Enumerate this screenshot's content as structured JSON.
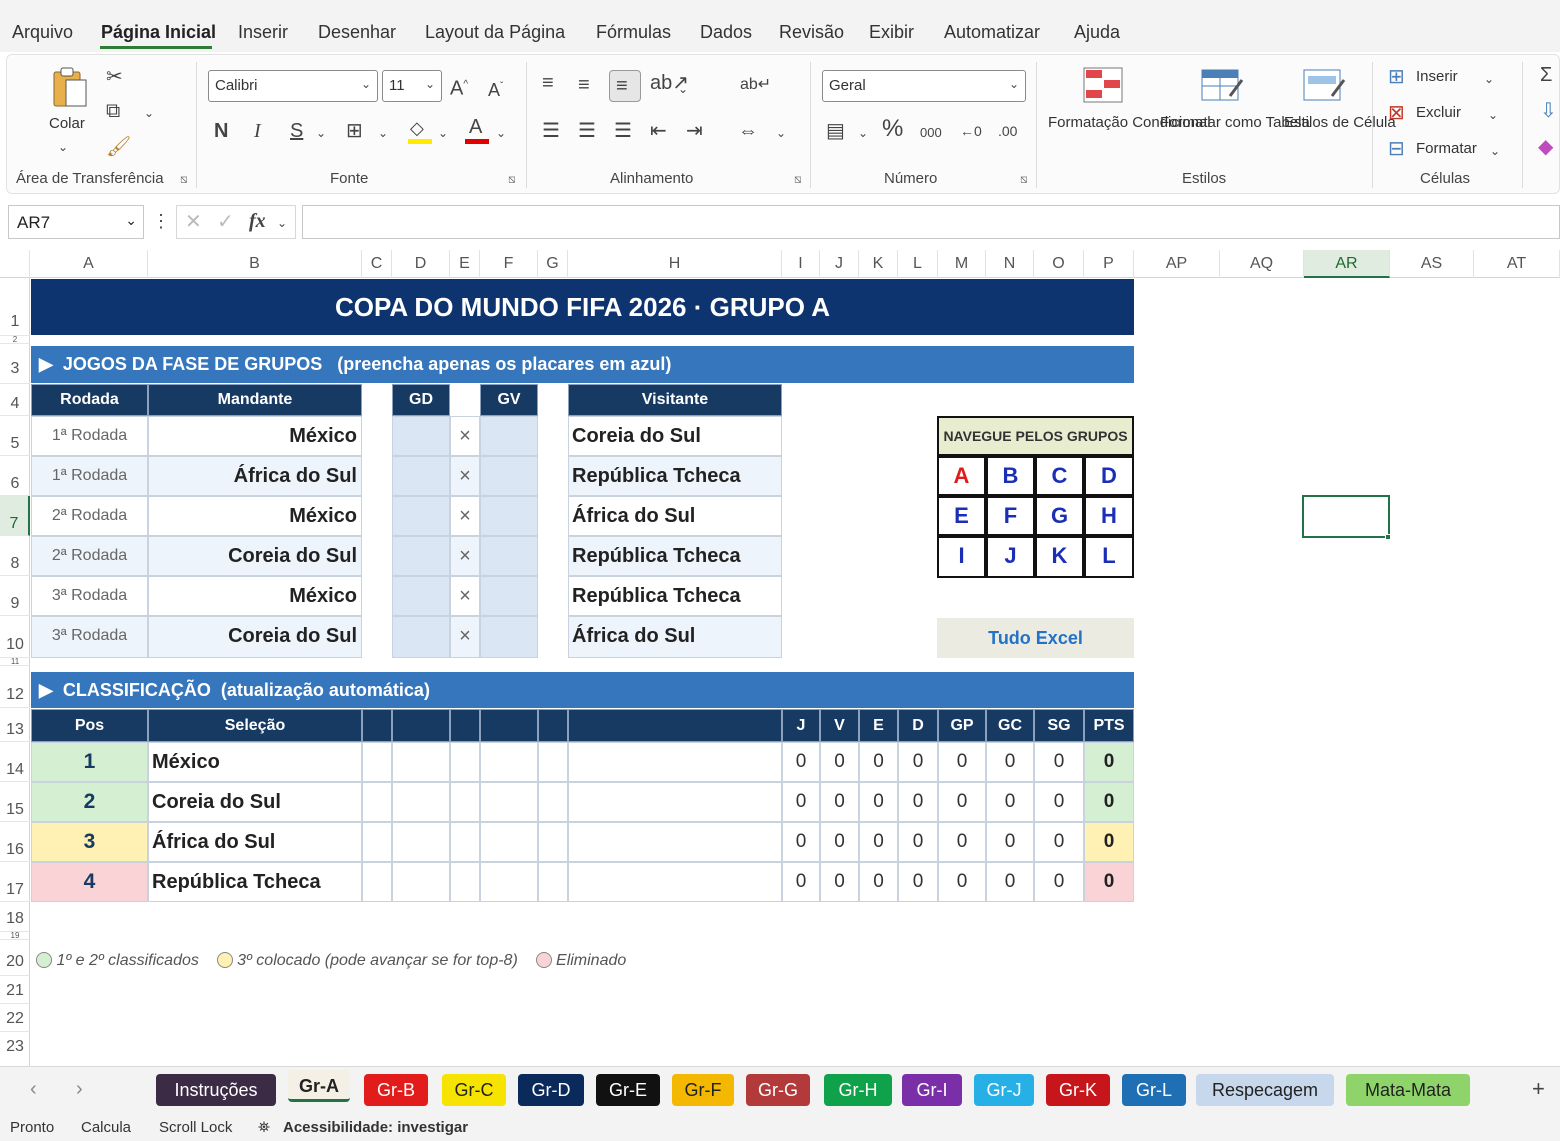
{
  "menu": [
    "Arquivo",
    "Página Inicial",
    "Inserir",
    "Desenhar",
    "Layout da Página",
    "Fórmulas",
    "Dados",
    "Revisão",
    "Exibir",
    "Automatizar",
    "Ajuda"
  ],
  "ribbon": {
    "clipboard": {
      "paste_label": "Colar",
      "group_label": "Área de Transferência"
    },
    "font": {
      "font_name": "Calibri",
      "font_size": "11",
      "bold": "N",
      "italic": "I",
      "underline": "S",
      "group_label": "Fonte"
    },
    "alignment": {
      "group_label": "Alinhamento"
    },
    "number": {
      "format": "Geral",
      "group_label": "Número"
    },
    "styles": {
      "cond_format": "Formatação Condicional",
      "format_table": "Formatar como Tabela",
      "cell_styles": "Estilos de Célula",
      "group_label": "Estilos"
    },
    "cells": {
      "insert": "Inserir",
      "delete": "Excluir",
      "format": "Formatar",
      "group_label": "Células"
    }
  },
  "formula_bar": {
    "name_box": "AR7",
    "fx": "fx"
  },
  "columns": [
    "A",
    "B",
    "C",
    "D",
    "E",
    "F",
    "G",
    "H",
    "I",
    "J",
    "K",
    "L",
    "M",
    "N",
    "O",
    "P",
    "AP",
    "AQ",
    "AR",
    "AS",
    "AT"
  ],
  "rows": [
    "1",
    "2",
    "3",
    "4",
    "5",
    "6",
    "7",
    "8",
    "9",
    "10",
    "11",
    "12",
    "13",
    "14",
    "15",
    "16",
    "17",
    "18",
    "19",
    "20",
    "21",
    "22",
    "23"
  ],
  "sheet": {
    "title": "COPA DO MUNDO FIFA 2026  ·  GRUPO A",
    "matches_section": "JOGOS DA FASE DE GRUPOS",
    "matches_hint": "(preencha apenas os placares em azul)",
    "match_headers": {
      "rodada": "Rodada",
      "mandante": "Mandante",
      "gd": "GD",
      "gv": "GV",
      "visitante": "Visitante"
    },
    "matches": [
      {
        "rodada": "1ª Rodada",
        "home": "México",
        "away": "Coreia do Sul"
      },
      {
        "rodada": "1ª Rodada",
        "home": "África do Sul",
        "away": "República Tcheca"
      },
      {
        "rodada": "2ª Rodada",
        "home": "México",
        "away": "África do Sul"
      },
      {
        "rodada": "2ª Rodada",
        "home": "Coreia do Sul",
        "away": "República Tcheca"
      },
      {
        "rodada": "3ª Rodada",
        "home": "México",
        "away": "República Tcheca"
      },
      {
        "rodada": "3ª Rodada",
        "home": "Coreia do Sul",
        "away": "África do Sul"
      }
    ],
    "vs_symbol": "×",
    "nav": {
      "title": "NAVEGUE PELOS GRUPOS",
      "groups": [
        "A",
        "B",
        "C",
        "D",
        "E",
        "F",
        "G",
        "H",
        "I",
        "J",
        "K",
        "L"
      ],
      "brand": "Tudo Excel"
    },
    "standings_section": "CLASSIFICAÇÃO",
    "standings_hint": "(atualização automática)",
    "standings_headers": [
      "Pos",
      "Seleção",
      "J",
      "V",
      "E",
      "D",
      "GP",
      "GC",
      "SG",
      "PTS"
    ],
    "standings": [
      {
        "pos": "1",
        "team": "México",
        "j": "0",
        "v": "0",
        "e": "0",
        "d": "0",
        "gp": "0",
        "gc": "0",
        "sg": "0",
        "pts": "0"
      },
      {
        "pos": "2",
        "team": "Coreia do Sul",
        "j": "0",
        "v": "0",
        "e": "0",
        "d": "0",
        "gp": "0",
        "gc": "0",
        "sg": "0",
        "pts": "0"
      },
      {
        "pos": "3",
        "team": "África do Sul",
        "j": "0",
        "v": "0",
        "e": "0",
        "d": "0",
        "gp": "0",
        "gc": "0",
        "sg": "0",
        "pts": "0"
      },
      {
        "pos": "4",
        "team": "República Tcheca",
        "j": "0",
        "v": "0",
        "e": "0",
        "d": "0",
        "gp": "0",
        "gc": "0",
        "sg": "0",
        "pts": "0"
      }
    ],
    "legend": [
      "1º e 2º classificados",
      "3º colocado (pode avançar se for top-8)",
      "Eliminado"
    ]
  },
  "tabs": [
    {
      "label": "Instruções",
      "bg": "#3b2b45",
      "fg": "#ffffff"
    },
    {
      "label": "Gr-A",
      "bg": "#f5f0e6",
      "fg": "#222222"
    },
    {
      "label": "Gr-B",
      "bg": "#e21b1b",
      "fg": "#ffffff"
    },
    {
      "label": "Gr-C",
      "bg": "#f6e400",
      "fg": "#222222"
    },
    {
      "label": "Gr-D",
      "bg": "#0b2a5c",
      "fg": "#ffffff"
    },
    {
      "label": "Gr-E",
      "bg": "#111111",
      "fg": "#ffffff"
    },
    {
      "label": "Gr-F",
      "bg": "#f5b800",
      "fg": "#222222"
    },
    {
      "label": "Gr-G",
      "bg": "#b33a3a",
      "fg": "#ffffff"
    },
    {
      "label": "Gr-H",
      "bg": "#0fa24a",
      "fg": "#ffffff"
    },
    {
      "label": "Gr-I",
      "bg": "#7a2fa8",
      "fg": "#ffffff"
    },
    {
      "label": "Gr-J",
      "bg": "#27b0e6",
      "fg": "#ffffff"
    },
    {
      "label": "Gr-K",
      "bg": "#c6161b",
      "fg": "#ffffff"
    },
    {
      "label": "Gr-L",
      "bg": "#1f6fb5",
      "fg": "#ffffff"
    },
    {
      "label": "Respecagem",
      "bg": "#c7d7ec",
      "fg": "#222222"
    },
    {
      "label": "Mata-Mata",
      "bg": "#8fd46a",
      "fg": "#222222"
    }
  ],
  "status": [
    "Pronto",
    "Calcula",
    "Scroll Lock",
    "Acessibilidade: investigar"
  ],
  "colors": {
    "navy": "#173a63",
    "title_bg": "#0e3470",
    "section_bg": "#3676bd",
    "score_bg": "#dbe6f5",
    "green": "#d5efd2",
    "yellow": "#fff0b3",
    "red": "#f9d3d6",
    "excel_green": "#217346"
  }
}
